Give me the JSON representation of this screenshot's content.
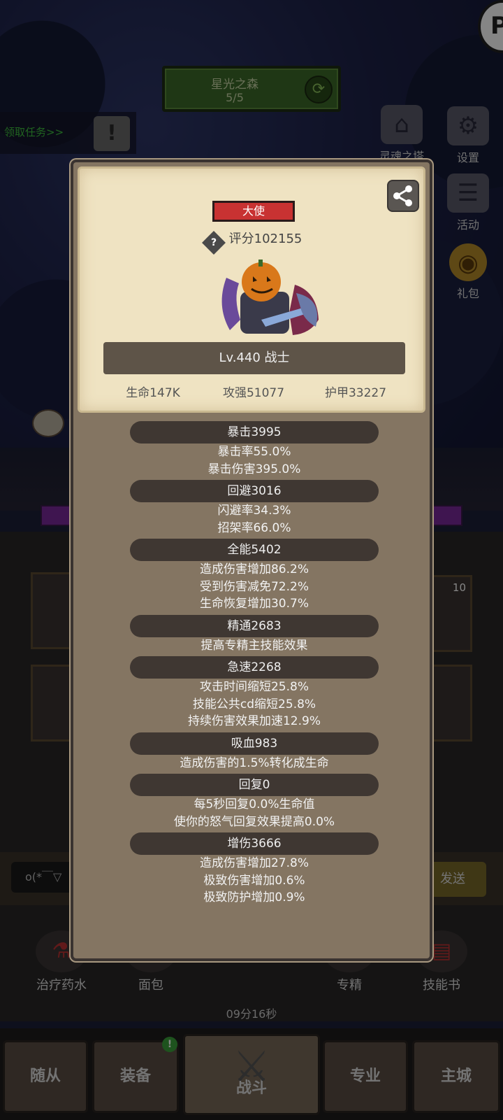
{
  "background": {
    "region": {
      "name": "星光之森",
      "progress": "5/5"
    },
    "task_text": "领取任务>>",
    "corner_badge": "P",
    "side_menu": [
      {
        "label": "灵魂之塔",
        "icon": "tower-icon"
      },
      {
        "label": "设置",
        "icon": "gear-icon"
      },
      {
        "label": "活动",
        "icon": "scroll-icon"
      },
      {
        "label": "礼包",
        "icon": "gift-icon"
      }
    ],
    "slot_count": "10",
    "chat": {
      "input_text": "o(*￣▽",
      "send_label": "发送"
    },
    "quick_items": [
      {
        "label": "治疗药水",
        "icon": "potion-icon"
      },
      {
        "label": "面包",
        "icon": "bread-icon"
      },
      {
        "label": "专精",
        "icon": "target-icon"
      },
      {
        "label": "技能书",
        "icon": "book-icon"
      }
    ],
    "timer": "09分16秒",
    "nav_tabs": [
      "随从",
      "装备",
      "战斗",
      "专业",
      "主城"
    ],
    "nav_badge": "!"
  },
  "panel": {
    "title_badge": "大使",
    "score_label": "评分102155",
    "level_class": "Lv.440 战士",
    "stats": {
      "hp": "生命147K",
      "attack": "攻强51077",
      "armor": "护甲33227"
    },
    "attributes": [
      {
        "header": "暴击3995",
        "lines": [
          "暴击率55.0%",
          "暴击伤害395.0%"
        ]
      },
      {
        "header": "回避3016",
        "lines": [
          "闪避率34.3%",
          "招架率66.0%"
        ]
      },
      {
        "header": "全能5402",
        "lines": [
          "造成伤害增加86.2%",
          "受到伤害减免72.2%",
          "生命恢复增加30.7%"
        ]
      },
      {
        "header": "精通2683",
        "lines": [
          "提高专精主技能效果"
        ]
      },
      {
        "header": "急速2268",
        "lines": [
          "攻击时间缩短25.8%",
          "技能公共cd缩短25.8%",
          "持续伤害效果加速12.9%"
        ]
      },
      {
        "header": "吸血983",
        "lines": [
          "造成伤害的1.5%转化成生命"
        ]
      },
      {
        "header": "回复0",
        "lines": [
          "每5秒回复0.0%生命值",
          "使你的怒气回复效果提高0.0%"
        ]
      },
      {
        "header": "增伤3666",
        "lines": [
          "造成伤害增加27.8%",
          "极致伤害增加0.6%",
          "极致防护增加0.9%"
        ]
      }
    ]
  },
  "colors": {
    "title_badge": "#c83232",
    "panel_bg": "#847562",
    "card_bg": "#efe3c2",
    "attr_header_bg": "#3f3732"
  }
}
